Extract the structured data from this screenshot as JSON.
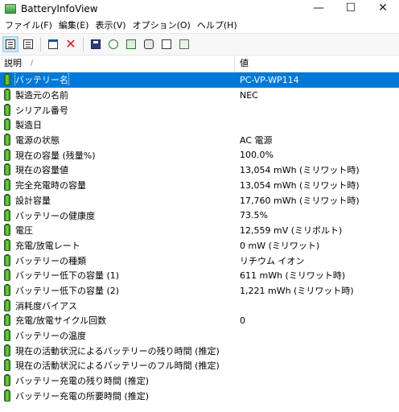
{
  "window": {
    "title": "BatteryInfoView",
    "minimize": "—",
    "maximize": "☐",
    "close": "✕"
  },
  "menu": [
    "ファイル(F)",
    "編集(E)",
    "表示(V)",
    "オプション(O)",
    "ヘルプ(H)"
  ],
  "toolbar_icons": [
    "properties-icon",
    "document-icon",
    "window-icon",
    "delete-icon",
    "save-icon",
    "refresh-icon",
    "copy-icon",
    "options-icon",
    "find-icon",
    "exit-icon"
  ],
  "columns": {
    "description": "説明",
    "value": "値",
    "sort_indicator": "/"
  },
  "rows": [
    {
      "label": "バッテリー名",
      "value": "PC-VP-WP114"
    },
    {
      "label": "製造元の名前",
      "value": "NEC"
    },
    {
      "label": "シリアル番号",
      "value": ""
    },
    {
      "label": "製造日",
      "value": ""
    },
    {
      "label": "電源の状態",
      "value": "AC 電源"
    },
    {
      "label": "現在の容量 (残量%)",
      "value": "100.0%"
    },
    {
      "label": "現在の容量値",
      "value": "13,054 mWh (ミリワット時)"
    },
    {
      "label": "完全充電時の容量",
      "value": "13,054 mWh (ミリワット時)"
    },
    {
      "label": "設計容量",
      "value": "17,760 mWh (ミリワット時)"
    },
    {
      "label": "バッテリーの健康度",
      "value": "73.5%"
    },
    {
      "label": "電圧",
      "value": "12,559 mV (ミリボルト)"
    },
    {
      "label": "充電/放電レート",
      "value": "0 mW (ミリワット)"
    },
    {
      "label": "バッテリーの種類",
      "value": "リチウム イオン"
    },
    {
      "label": "バッテリー低下の容量 (1)",
      "value": "611 mWh (ミリワット時)"
    },
    {
      "label": "バッテリー低下の容量 (2)",
      "value": "1,221 mWh (ミリワット時)"
    },
    {
      "label": "消耗度バイアス",
      "value": ""
    },
    {
      "label": "充電/放電サイクル回数",
      "value": "0"
    },
    {
      "label": "バッテリーの温度",
      "value": ""
    },
    {
      "label": "現在の活動状況によるバッテリーの残り時間 (推定)",
      "value": ""
    },
    {
      "label": "現在の活動状況によるバッテリーのフル時間 (推定)",
      "value": ""
    },
    {
      "label": "バッテリー充電の残り時間 (推定)",
      "value": ""
    },
    {
      "label": "バッテリー充電の所要時間 (推定)",
      "value": ""
    }
  ],
  "selection": {
    "selected_row": 0,
    "selection_color": "#0078d7"
  },
  "colors": {
    "battery_icon": "#3c8d22"
  }
}
